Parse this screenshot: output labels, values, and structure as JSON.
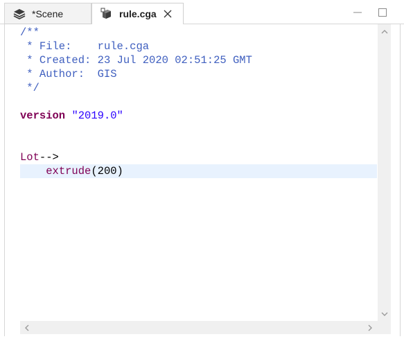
{
  "tabs": [
    {
      "label": "*Scene",
      "icon": "layers-icon",
      "active": false
    },
    {
      "label": "rule.cga",
      "icon": "cga-file-icon",
      "active": true
    }
  ],
  "editor": {
    "comment": {
      "open": "/**",
      "file_key": " * File:",
      "file_value": "rule.cga",
      "created_key": " * Created:",
      "created_value": "23 Jul 2020 02:51:25 GMT",
      "author_key": " * Author:",
      "author_value": "GIS",
      "close": " */"
    },
    "version_keyword": "version",
    "version_value": "\"2019.0\"",
    "rule_name": "Lot",
    "rule_arrow": "-->",
    "operation": "extrude",
    "operation_args": "(200)"
  },
  "colors": {
    "comment": "#3f5fbf",
    "keyword": "#7f0055",
    "string": "#2a00ff",
    "current_line": "#e8f2fe"
  },
  "window_controls": {
    "minimize_icon": "minimize-icon",
    "maximize_icon": "maximize-icon"
  }
}
